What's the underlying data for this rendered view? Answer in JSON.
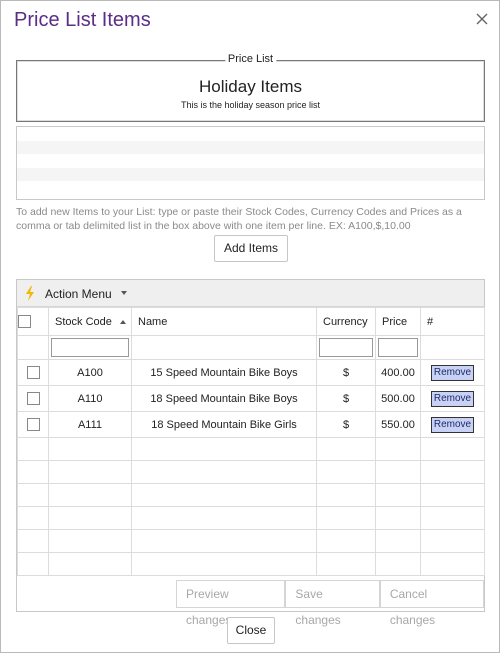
{
  "dialog": {
    "title": "Price List Items"
  },
  "price_list": {
    "legend": "Price List",
    "name": "Holiday Items",
    "description": "This is the holiday season price list"
  },
  "input": {
    "help_text": "To add new Items to your List: type or paste their Stock Codes, Currency Codes and Prices as a comma or tab delimited list in the box above with one item per line. EX: A100,$,10.00",
    "add_button": "Add Items"
  },
  "grid": {
    "action_menu": "Action Menu",
    "columns": {
      "stock_code": "Stock Code",
      "name": "Name",
      "currency": "Currency",
      "price": "Price",
      "hash": "#"
    },
    "rows": [
      {
        "stock_code": "A100",
        "name": "15 Speed Mountain Bike Boys",
        "currency": "$",
        "price": "400.00",
        "action": "Remove"
      },
      {
        "stock_code": "A110",
        "name": "18 Speed Mountain Bike Boys",
        "currency": "$",
        "price": "500.00",
        "action": "Remove"
      },
      {
        "stock_code": "A111",
        "name": "18 Speed Mountain Bike Girls",
        "currency": "$",
        "price": "550.00",
        "action": "Remove"
      }
    ],
    "footer": {
      "preview": "Preview changes",
      "save": "Save changes",
      "cancel": "Cancel changes"
    }
  },
  "close_label": "Close",
  "colors": {
    "title": "#5b2d86",
    "bolt": "#f2b705",
    "remove_bg": "#c9d2f5"
  }
}
